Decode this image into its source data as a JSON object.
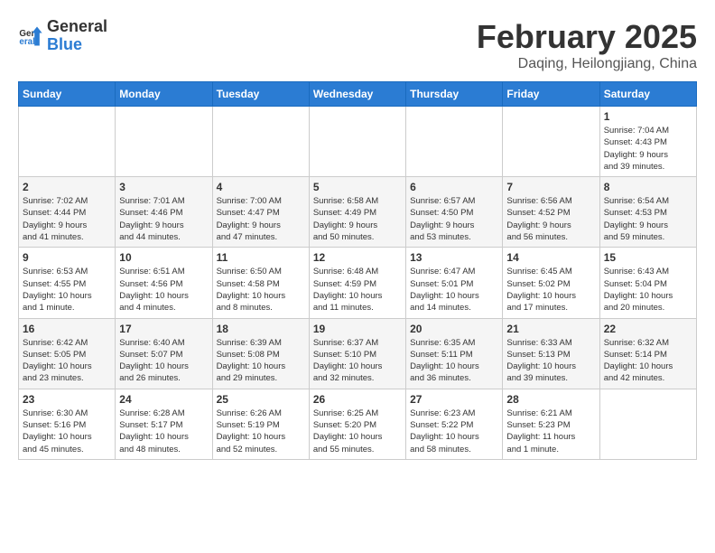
{
  "header": {
    "logo_line1": "General",
    "logo_line2": "Blue",
    "month_title": "February 2025",
    "location": "Daqing, Heilongjiang, China"
  },
  "weekdays": [
    "Sunday",
    "Monday",
    "Tuesday",
    "Wednesday",
    "Thursday",
    "Friday",
    "Saturday"
  ],
  "weeks": [
    [
      {
        "day": "",
        "info": ""
      },
      {
        "day": "",
        "info": ""
      },
      {
        "day": "",
        "info": ""
      },
      {
        "day": "",
        "info": ""
      },
      {
        "day": "",
        "info": ""
      },
      {
        "day": "",
        "info": ""
      },
      {
        "day": "1",
        "info": "Sunrise: 7:04 AM\nSunset: 4:43 PM\nDaylight: 9 hours\nand 39 minutes."
      }
    ],
    [
      {
        "day": "2",
        "info": "Sunrise: 7:02 AM\nSunset: 4:44 PM\nDaylight: 9 hours\nand 41 minutes."
      },
      {
        "day": "3",
        "info": "Sunrise: 7:01 AM\nSunset: 4:46 PM\nDaylight: 9 hours\nand 44 minutes."
      },
      {
        "day": "4",
        "info": "Sunrise: 7:00 AM\nSunset: 4:47 PM\nDaylight: 9 hours\nand 47 minutes."
      },
      {
        "day": "5",
        "info": "Sunrise: 6:58 AM\nSunset: 4:49 PM\nDaylight: 9 hours\nand 50 minutes."
      },
      {
        "day": "6",
        "info": "Sunrise: 6:57 AM\nSunset: 4:50 PM\nDaylight: 9 hours\nand 53 minutes."
      },
      {
        "day": "7",
        "info": "Sunrise: 6:56 AM\nSunset: 4:52 PM\nDaylight: 9 hours\nand 56 minutes."
      },
      {
        "day": "8",
        "info": "Sunrise: 6:54 AM\nSunset: 4:53 PM\nDaylight: 9 hours\nand 59 minutes."
      }
    ],
    [
      {
        "day": "9",
        "info": "Sunrise: 6:53 AM\nSunset: 4:55 PM\nDaylight: 10 hours\nand 1 minute."
      },
      {
        "day": "10",
        "info": "Sunrise: 6:51 AM\nSunset: 4:56 PM\nDaylight: 10 hours\nand 4 minutes."
      },
      {
        "day": "11",
        "info": "Sunrise: 6:50 AM\nSunset: 4:58 PM\nDaylight: 10 hours\nand 8 minutes."
      },
      {
        "day": "12",
        "info": "Sunrise: 6:48 AM\nSunset: 4:59 PM\nDaylight: 10 hours\nand 11 minutes."
      },
      {
        "day": "13",
        "info": "Sunrise: 6:47 AM\nSunset: 5:01 PM\nDaylight: 10 hours\nand 14 minutes."
      },
      {
        "day": "14",
        "info": "Sunrise: 6:45 AM\nSunset: 5:02 PM\nDaylight: 10 hours\nand 17 minutes."
      },
      {
        "day": "15",
        "info": "Sunrise: 6:43 AM\nSunset: 5:04 PM\nDaylight: 10 hours\nand 20 minutes."
      }
    ],
    [
      {
        "day": "16",
        "info": "Sunrise: 6:42 AM\nSunset: 5:05 PM\nDaylight: 10 hours\nand 23 minutes."
      },
      {
        "day": "17",
        "info": "Sunrise: 6:40 AM\nSunset: 5:07 PM\nDaylight: 10 hours\nand 26 minutes."
      },
      {
        "day": "18",
        "info": "Sunrise: 6:39 AM\nSunset: 5:08 PM\nDaylight: 10 hours\nand 29 minutes."
      },
      {
        "day": "19",
        "info": "Sunrise: 6:37 AM\nSunset: 5:10 PM\nDaylight: 10 hours\nand 32 minutes."
      },
      {
        "day": "20",
        "info": "Sunrise: 6:35 AM\nSunset: 5:11 PM\nDaylight: 10 hours\nand 36 minutes."
      },
      {
        "day": "21",
        "info": "Sunrise: 6:33 AM\nSunset: 5:13 PM\nDaylight: 10 hours\nand 39 minutes."
      },
      {
        "day": "22",
        "info": "Sunrise: 6:32 AM\nSunset: 5:14 PM\nDaylight: 10 hours\nand 42 minutes."
      }
    ],
    [
      {
        "day": "23",
        "info": "Sunrise: 6:30 AM\nSunset: 5:16 PM\nDaylight: 10 hours\nand 45 minutes."
      },
      {
        "day": "24",
        "info": "Sunrise: 6:28 AM\nSunset: 5:17 PM\nDaylight: 10 hours\nand 48 minutes."
      },
      {
        "day": "25",
        "info": "Sunrise: 6:26 AM\nSunset: 5:19 PM\nDaylight: 10 hours\nand 52 minutes."
      },
      {
        "day": "26",
        "info": "Sunrise: 6:25 AM\nSunset: 5:20 PM\nDaylight: 10 hours\nand 55 minutes."
      },
      {
        "day": "27",
        "info": "Sunrise: 6:23 AM\nSunset: 5:22 PM\nDaylight: 10 hours\nand 58 minutes."
      },
      {
        "day": "28",
        "info": "Sunrise: 6:21 AM\nSunset: 5:23 PM\nDaylight: 11 hours\nand 1 minute."
      },
      {
        "day": "",
        "info": ""
      }
    ]
  ]
}
